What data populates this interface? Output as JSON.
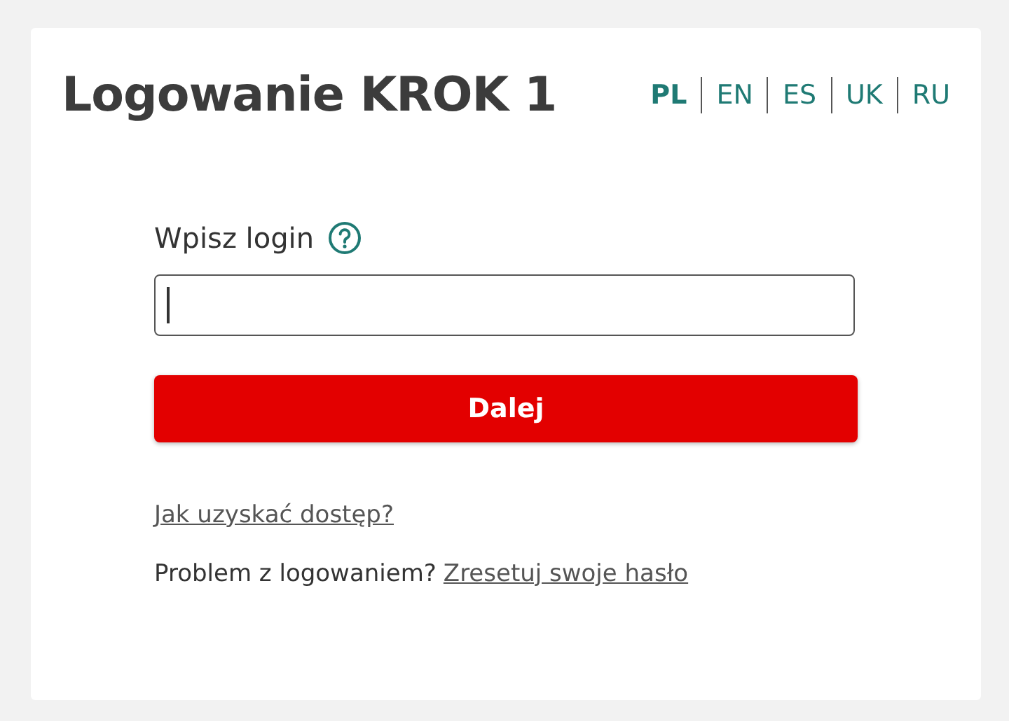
{
  "title": "Logowanie KROK 1",
  "languages": [
    {
      "label": "PL",
      "selected": true
    },
    {
      "label": "EN",
      "selected": false
    },
    {
      "label": "ES",
      "selected": false
    },
    {
      "label": "UK",
      "selected": false
    },
    {
      "label": "RU",
      "selected": false
    }
  ],
  "login": {
    "label": "Wpisz login",
    "focused": true
  },
  "submit": "Dalej",
  "access_link": "Jak uzyskać dostęp?",
  "problem": {
    "text": "Problem z logowaniem?",
    "link": "Zresetuj swoje hasło"
  }
}
